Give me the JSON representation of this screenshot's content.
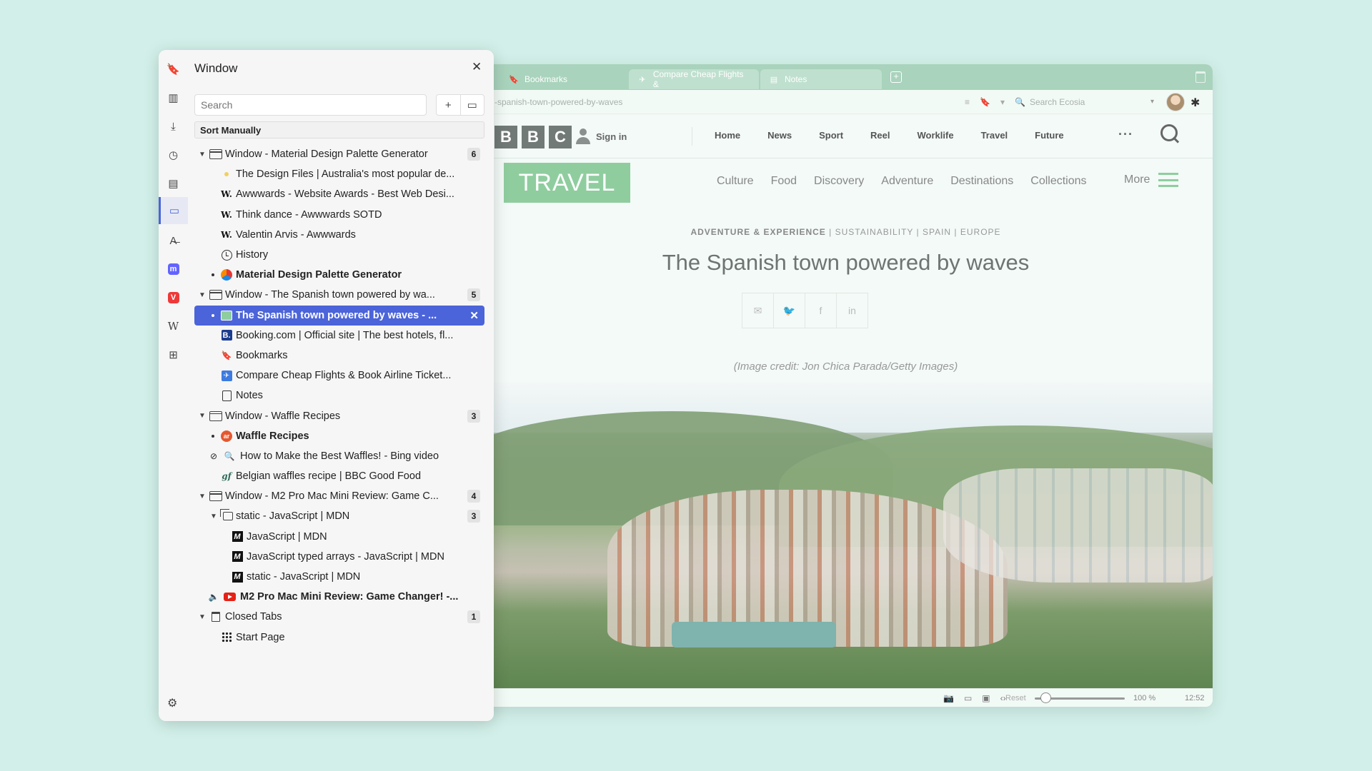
{
  "browser": {
    "tabs": [
      {
        "label": "Bookmarks",
        "icon": "bookmark-icon"
      },
      {
        "label": "Compare Cheap Flights &",
        "icon": "flights-icon"
      },
      {
        "label": "Notes",
        "icon": "notes-icon"
      }
    ],
    "url": "-spanish-town-powered-by-waves",
    "search_placeholder": "Search Ecosia",
    "page": {
      "bbc_logo": [
        "B",
        "B",
        "C"
      ],
      "sign_in": "Sign in",
      "nav": [
        "Home",
        "News",
        "Sport",
        "Reel",
        "Worklife",
        "Travel",
        "Future"
      ],
      "nav_more": "···",
      "section_logo": "TRAVEL",
      "section_links": [
        "Culture",
        "Food",
        "Discovery",
        "Adventure",
        "Destinations",
        "Collections"
      ],
      "section_more": "More",
      "tags_primary": "ADVENTURE & EXPERIENCE",
      "tags_rest": " | SUSTAINABILITY | SPAIN | EUROPE",
      "title": "The Spanish town powered by waves",
      "share_icons": [
        "✉",
        "🐦",
        "f",
        "in"
      ],
      "image_credit": "(Image credit: Jon Chica Parada/Getty Images)"
    },
    "status": {
      "reset": "Reset",
      "zoom": "100 %",
      "time": "12:52",
      "zoom_level": 0.12
    }
  },
  "panel": {
    "title": "Window",
    "search_placeholder": "Search",
    "sort_label": "Sort Manually",
    "rail_icons": [
      "bookmark-icon",
      "reading-list-icon",
      "downloads-icon",
      "history-icon",
      "notes-icon",
      "window-icon",
      "translate-icon",
      "mastodon-icon",
      "vivaldi-icon",
      "wikipedia-icon",
      "add-panel-icon"
    ],
    "tree": [
      {
        "type": "window",
        "label": "Window - Material Design Palette Generator",
        "count": "6"
      },
      {
        "type": "tab",
        "label": "The Design Files | Australia's most popular de...",
        "icon": "designfiles-icon"
      },
      {
        "type": "tab",
        "label": "Awwwards - Website Awards - Best Web Desi...",
        "icon": "awwwards-icon"
      },
      {
        "type": "tab",
        "label": "Think dance - Awwwards SOTD",
        "icon": "awwwards-icon"
      },
      {
        "type": "tab",
        "label": "Valentin Arvis - Awwwards",
        "icon": "awwwards-icon"
      },
      {
        "type": "tab",
        "label": "History",
        "icon": "history-icon"
      },
      {
        "type": "tab-active",
        "label": "Material Design Palette Generator",
        "icon": "palette-icon"
      },
      {
        "type": "window",
        "label": "Window - The Spanish town powered by wa...",
        "count": "5"
      },
      {
        "type": "tab-selected",
        "label": "The Spanish town powered by waves - ...",
        "icon": "bbc-travel-icon"
      },
      {
        "type": "tab",
        "label": "Booking.com | Official site | The best hotels, fl...",
        "icon": "booking-icon"
      },
      {
        "type": "tab",
        "label": "Bookmarks",
        "icon": "bookmark-icon"
      },
      {
        "type": "tab",
        "label": "Compare Cheap Flights & Book Airline Ticket...",
        "icon": "flights-icon"
      },
      {
        "type": "tab",
        "label": "Notes",
        "icon": "notes-icon"
      },
      {
        "type": "window",
        "label": "Window - Waffle Recipes",
        "count": "3"
      },
      {
        "type": "tab-active",
        "label": "Waffle Recipes",
        "icon": "allrecipes-icon"
      },
      {
        "type": "tab-muted",
        "label": "How to Make the Best Waffles! - Bing video",
        "icon": "bing-icon"
      },
      {
        "type": "tab",
        "label": "Belgian waffles recipe | BBC Good Food",
        "icon": "goodfood-icon"
      },
      {
        "type": "window",
        "label": "Window - M2 Pro Mac Mini Review: Game C...",
        "count": "4"
      },
      {
        "type": "stack",
        "label": "static - JavaScript | MDN",
        "count": "3"
      },
      {
        "type": "stack-tab",
        "label": "JavaScript | MDN",
        "icon": "mdn-icon"
      },
      {
        "type": "stack-tab",
        "label": "JavaScript typed arrays - JavaScript | MDN",
        "icon": "mdn-icon"
      },
      {
        "type": "stack-tab",
        "label": "static - JavaScript | MDN",
        "icon": "mdn-icon"
      },
      {
        "type": "tab-audio",
        "label": "M2 Pro Mac Mini Review: Game Changer! -...",
        "icon": "youtube-icon"
      },
      {
        "type": "closed",
        "label": "Closed Tabs",
        "count": "1"
      },
      {
        "type": "tab",
        "label": "Start Page",
        "icon": "grid-icon"
      }
    ]
  },
  "colors": {
    "accent": "#4b64d9",
    "background": "#d2f0e9",
    "travel_green": "#8fcd9f"
  }
}
